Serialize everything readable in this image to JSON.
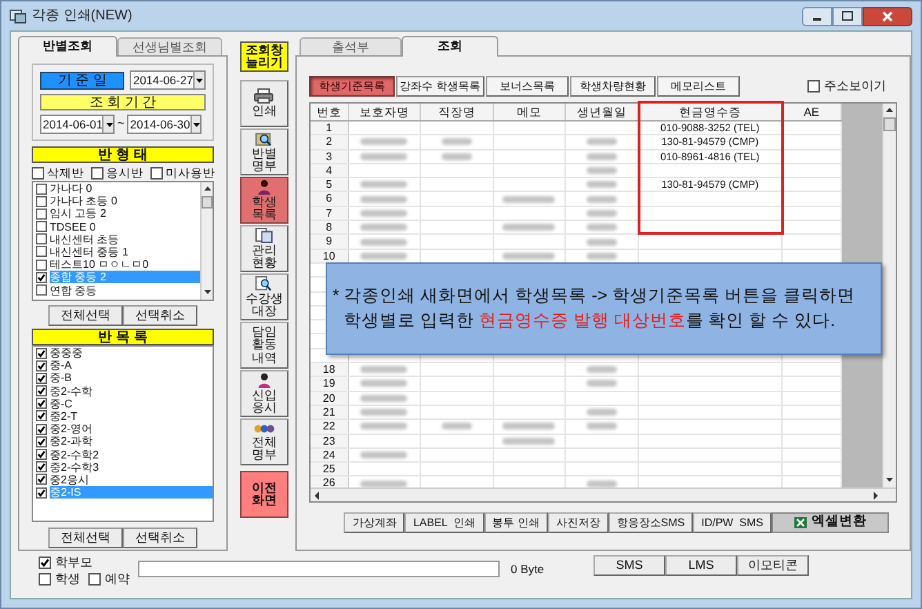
{
  "window": {
    "title": "각종 인쇄(NEW)"
  },
  "left_tabs": [
    {
      "label": "반별조회",
      "selected": true
    },
    {
      "label": "선생님별조회",
      "selected": false
    }
  ],
  "base_date": {
    "label": "기 준 일",
    "value": "2014-06-27"
  },
  "period": {
    "label": "조 회 기 간",
    "from": "2014-06-01",
    "separator": "~",
    "to": "2014-06-30"
  },
  "class_type": {
    "label": "반 형 태",
    "filters": [
      {
        "label": "삭제반",
        "checked": false
      },
      {
        "label": "응시반",
        "checked": false
      },
      {
        "label": "미사용반",
        "checked": false
      }
    ],
    "items": [
      {
        "label": "가나다 0",
        "checked": false,
        "selected": false
      },
      {
        "label": "가나다 초등 0",
        "checked": false,
        "selected": false
      },
      {
        "label": "임시 고등 2",
        "checked": false,
        "selected": false
      },
      {
        "label": "TDSEE 0",
        "checked": false,
        "selected": false
      },
      {
        "label": "내신센터 초등",
        "checked": false,
        "selected": false
      },
      {
        "label": "내신센터 중등 1",
        "checked": false,
        "selected": false
      },
      {
        "label": "테스트10 ㅁㅇㄴㅁ0",
        "checked": false,
        "selected": false
      },
      {
        "label": "종합 중등 2",
        "checked": true,
        "selected": true
      },
      {
        "label": "연합 중등",
        "checked": false,
        "selected": false
      }
    ],
    "buttons": [
      "전체선택",
      "선택취소"
    ]
  },
  "class_list": {
    "label": "반 목 록",
    "items": [
      {
        "label": "중중중",
        "checked": true,
        "selected": false
      },
      {
        "label": "중-A",
        "checked": true,
        "selected": false
      },
      {
        "label": "중-B",
        "checked": true,
        "selected": false
      },
      {
        "label": "중2-수학",
        "checked": true,
        "selected": false
      },
      {
        "label": "중-C",
        "checked": true,
        "selected": false
      },
      {
        "label": "중2-T",
        "checked": true,
        "selected": false
      },
      {
        "label": "중2-영어",
        "checked": true,
        "selected": false
      },
      {
        "label": "중2-과학",
        "checked": true,
        "selected": false
      },
      {
        "label": "중2-수학2",
        "checked": true,
        "selected": false
      },
      {
        "label": "중2-수학3",
        "checked": true,
        "selected": false
      },
      {
        "label": "중2응시",
        "checked": true,
        "selected": false
      },
      {
        "label": "중2-IS",
        "checked": true,
        "selected": true
      }
    ],
    "buttons": [
      "전체선택",
      "선택취소"
    ]
  },
  "side_buttons": [
    {
      "label": "조회창 늘리기",
      "kind": "highlight"
    },
    {
      "label": "인쇄",
      "kind": "tool"
    },
    {
      "label": "반별 명부",
      "kind": "tool"
    },
    {
      "label": "학생 목록",
      "kind": "active"
    },
    {
      "label": "관리 현황",
      "kind": "tool"
    },
    {
      "label": "수강생 대장",
      "kind": "tool"
    },
    {
      "label": "담임 활동 내역",
      "kind": "plain"
    },
    {
      "label": "신입 응시",
      "kind": "tool"
    },
    {
      "label": "전체 명부",
      "kind": "tool"
    },
    {
      "label": "이전 화면",
      "kind": "back"
    }
  ],
  "right_tabs": [
    {
      "label": "출석부",
      "selected": false
    },
    {
      "label": "조회",
      "selected": true
    }
  ],
  "list_buttons": [
    {
      "label": "학생기준목록",
      "selected": true
    },
    {
      "label": "강좌수 학생목록",
      "selected": false
    },
    {
      "label": "보너스목록",
      "selected": false
    },
    {
      "label": "학생차량현황",
      "selected": false
    },
    {
      "label": "메모리스트",
      "selected": false
    }
  ],
  "show_address": {
    "label": "주소보이기",
    "checked": false
  },
  "table": {
    "columns": [
      "번호",
      "보호자명",
      "직장명",
      "메모",
      "생년월일",
      "현금영수증",
      "AE"
    ],
    "rows_top": [
      {
        "number": "1",
        "blurred": [
          false,
          false,
          false,
          false
        ],
        "receipt": "010-9088-3252 (TEL)"
      },
      {
        "number": "2",
        "blurred": [
          true,
          true,
          false,
          true
        ],
        "receipt": "130-81-94579 (CMP)"
      },
      {
        "number": "3",
        "blurred": [
          true,
          true,
          false,
          true
        ],
        "receipt": "010-8961-4816 (TEL)"
      },
      {
        "number": "4",
        "blurred": [
          false,
          false,
          false,
          true
        ]
      },
      {
        "number": "5",
        "blurred": [
          true,
          false,
          false,
          true
        ],
        "receipt": "130-81-94579 (CMP)"
      },
      {
        "number": "6",
        "blurred": [
          true,
          false,
          true,
          true
        ]
      },
      {
        "number": "7",
        "blurred": [
          true,
          false,
          false,
          true
        ]
      },
      {
        "number": "8",
        "blurred": [
          true,
          false,
          true,
          true
        ]
      },
      {
        "number": "9",
        "blurred": [
          true,
          false,
          false,
          true
        ]
      },
      {
        "number": "10",
        "blurred": [
          true,
          false,
          true,
          true
        ]
      }
    ],
    "rows_bottom": [
      {
        "number": "18",
        "blurred": [
          true,
          false,
          false,
          true
        ]
      },
      {
        "number": "19",
        "blurred": [
          true,
          false,
          false,
          true
        ]
      },
      {
        "number": "20",
        "blurred": [
          true,
          false,
          false,
          false
        ]
      },
      {
        "number": "21",
        "blurred": [
          true,
          false,
          false,
          true
        ]
      },
      {
        "number": "22",
        "blurred": [
          true,
          true,
          true,
          true
        ]
      },
      {
        "number": "23",
        "blurred": [
          false,
          false,
          true,
          false
        ]
      },
      {
        "number": "24",
        "blurred": [
          true,
          false,
          false,
          false
        ]
      },
      {
        "number": "25",
        "blurred": [
          false,
          false,
          false,
          false
        ]
      },
      {
        "number": "26",
        "blurred": [
          true,
          false,
          false,
          true
        ]
      }
    ]
  },
  "callout": {
    "line_1": "* 각종인쇄 새화면에서 학생목록 -> 학생기준목록 버튼을 클릭하면",
    "line_2": [
      {
        "text": "학생별로 입력한 ",
        "highlight": false
      },
      {
        "text": "현금영수증 발행 대상번호",
        "highlight": true
      },
      {
        "text": "를 확인 할 수 있다.",
        "highlight": false
      }
    ]
  },
  "action_buttons": [
    {
      "label": "가상계좌",
      "kind": "plain"
    },
    {
      "label": "LABEL  인쇄",
      "kind": "plain"
    },
    {
      "label": "봉투 인쇄",
      "kind": "plain"
    },
    {
      "label": "사진저장",
      "kind": "plain"
    },
    {
      "label": "항응장소SMS",
      "kind": "plain"
    },
    {
      "label": "ID/PW  SMS",
      "kind": "plain"
    },
    {
      "label": "엑셀변환",
      "kind": "excel"
    }
  ],
  "recipients": [
    {
      "label": "학부모",
      "checked": true
    },
    {
      "label": "학생",
      "checked": false
    },
    {
      "label": "예약",
      "checked": false
    }
  ],
  "byte_count": "0 Byte",
  "send_buttons": [
    "SMS",
    "LMS",
    "이모티콘"
  ]
}
